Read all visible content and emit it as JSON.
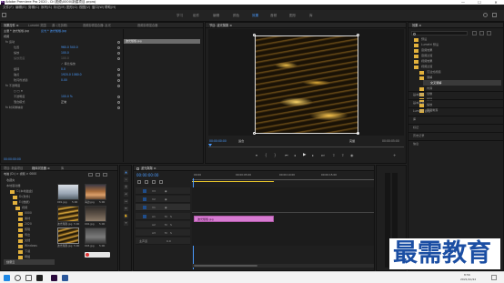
{
  "titlebar": {
    "title": "Adobe Premiere Pro 2020 - D:\\视频\\0000\\新建项目.prproj",
    "minimize": "—",
    "maximize": "☐",
    "close": "✕"
  },
  "menu": [
    "文件(F)",
    "编辑(E)",
    "剪辑(C)",
    "序列(S)",
    "标记(M)",
    "图形(G)",
    "视图(V)",
    "窗口(W)",
    "帮助(H)"
  ],
  "workspaces": {
    "items": [
      "学习",
      "组件",
      "编辑",
      "颜色",
      "效果",
      "音频",
      "图形",
      "库"
    ],
    "active": "效果"
  },
  "effect_controls": {
    "tabs": [
      "效果控件 ≡",
      "Lumetri 范围",
      "源: (无剪辑)",
      "音频剪辑混合器: 反光",
      "音频剪辑混合器"
    ],
    "header_left": "主要 * 波光粼粼.jpg",
    "header_right": "反光 * 波光粼粼.jpg",
    "clip_chip": "波光粼粼.jpg",
    "section_video": "视频",
    "rows": [
      {
        "label": "fx 运动",
        "value": ""
      },
      {
        "label": "位置",
        "value": "960.0   540.0"
      },
      {
        "label": "缩放",
        "value": "100.0"
      },
      {
        "label": "缩放宽度",
        "value": "100.0"
      },
      {
        "label": "",
        "value": "✓ 等比缩放"
      },
      {
        "label": "旋转",
        "value": "0.0"
      },
      {
        "label": "锚点",
        "value": "1920.0  1080.0"
      },
      {
        "label": "防闪烁滤镜",
        "value": "0.00"
      },
      {
        "label": "fx 不透明度",
        "value": ""
      },
      {
        "label": "",
        "value": "○ □ ✒"
      },
      {
        "label": "不透明度",
        "value": "100.0 %"
      },
      {
        "label": "混合模式",
        "value": "正常"
      },
      {
        "label": "fx 时间重映射",
        "value": ""
      }
    ],
    "timecode": "00:00:00:00"
  },
  "program": {
    "tab": "节目: 波光粼粼 ≡",
    "timecode_left": "00:00:00:00",
    "timecode_right": "00:00:05:00",
    "fit": "适合",
    "quality": "完整"
  },
  "effects_panel": {
    "title": "效果 ≡",
    "tree": [
      "预设",
      "Lumetri 预设",
      "音频效果",
      "音频过渡",
      "视频效果",
      "视频过渡",
      "沉浸式视频",
      "溶解",
      "交叉溶解",
      "内滑",
      "划像",
      "擦除",
      "缩放",
      "页面剥落"
    ],
    "lower": [
      "基本图形",
      "基本声音",
      "Lumetri 颜色",
      "库",
      "标记",
      "历史记录",
      "信息"
    ]
  },
  "project": {
    "tabs": [
      "项目: 新建项目",
      "媒体浏览器 ≡",
      "库"
    ],
    "path": "电脑 (D:) > 视频 > 0000",
    "tree": [
      "收藏夹",
      "本地驱动器",
      "C:(本地磁盘)",
      "D:(软件)",
      "E:(数据)",
      "视频",
      "0000",
      "素材",
      "2020",
      "剪辑",
      "导出",
      "文档",
      "Windows",
      "下载",
      "网络",
      "创意云"
    ],
    "thumbs": [
      {
        "label": "001.jpg",
        "dur": "5:00"
      },
      {
        "label": "海边.jpg",
        "dur": "5:00"
      },
      {
        "label": "波光粼粼.jpg",
        "dur": "5:00"
      },
      {
        "label": "002.jpg",
        "dur": "5:00"
      },
      {
        "label": "波光粼粼.jpg",
        "dur": "5:00"
      },
      {
        "label": "003.jpg",
        "dur": "5:00"
      }
    ]
  },
  "timeline": {
    "tab": "波光粼粼 ≡",
    "timecode": "00:00:00:00",
    "ruler": [
      "00:00",
      "00:00:05:00",
      "00:00:10:00",
      "00:00:15:00"
    ],
    "tracks_v": [
      "V3",
      "V2",
      "V1"
    ],
    "tracks_a": [
      "A1",
      "A2",
      "A3"
    ],
    "master": "主声道",
    "master_val": "0.0",
    "clip_label": "波光粼粼.jpg"
  },
  "watermark": "最需教育",
  "taskbar": {
    "time": "8:56",
    "date": "2021/10/22"
  },
  "colors": {
    "accent": "#4a9bff",
    "clip": "#d77bd2",
    "folder": "#e2b13c"
  }
}
